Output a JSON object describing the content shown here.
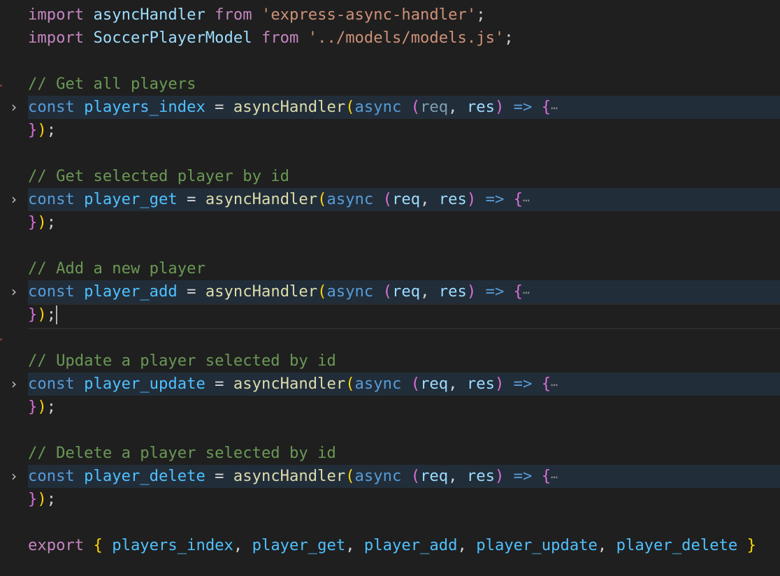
{
  "editor": {
    "theme_colors": {
      "background": "#1f1f1f",
      "folded_line_highlight": "#222d3a",
      "keyword": "#c586c0",
      "storage": "#569cd6",
      "variable": "#9cdcfe",
      "constant": "#4fc1ff",
      "function": "#dcdcaa",
      "string": "#ce9178",
      "comment": "#6a9955"
    },
    "imports": [
      {
        "keyword": "import",
        "name": "asyncHandler",
        "from": "from",
        "source": "'express-async-handler'",
        "end": ";"
      },
      {
        "keyword": "import",
        "name": "SoccerPlayerModel",
        "from": "from",
        "source": "'../models/models.js'",
        "end": ";"
      }
    ],
    "blocks": [
      {
        "comment": "// Get all players",
        "decl": "const",
        "name": "players_index",
        "req_unused": true
      },
      {
        "comment": "// Get selected player by id",
        "decl": "const",
        "name": "player_get",
        "req_unused": false
      },
      {
        "comment": "// Add a new player",
        "decl": "const",
        "name": "player_add",
        "req_unused": false,
        "has_cursor": true
      },
      {
        "comment": "// Update a player selected by id",
        "decl": "const",
        "name": "player_update",
        "req_unused": false
      },
      {
        "comment": "// Delete a player selected by id",
        "decl": "const",
        "name": "player_delete",
        "req_unused": false
      }
    ],
    "tokens": {
      "eq": "=",
      "handler": "asyncHandler",
      "open_paren": "(",
      "async": "async",
      "param_open": "(",
      "req": "req",
      "comma": ",",
      "res": "res",
      "param_close": ")",
      "arrow": "=>",
      "brace_open": "{",
      "ellipsis": "⋯",
      "brace_close": "}",
      "paren_close": ")",
      "semi": ";",
      "fold_icon": "›"
    },
    "export": {
      "keyword": "export",
      "open": "{",
      "names": [
        "players_index",
        "player_get",
        "player_add",
        "player_update",
        "player_delete"
      ],
      "close": "}"
    }
  }
}
